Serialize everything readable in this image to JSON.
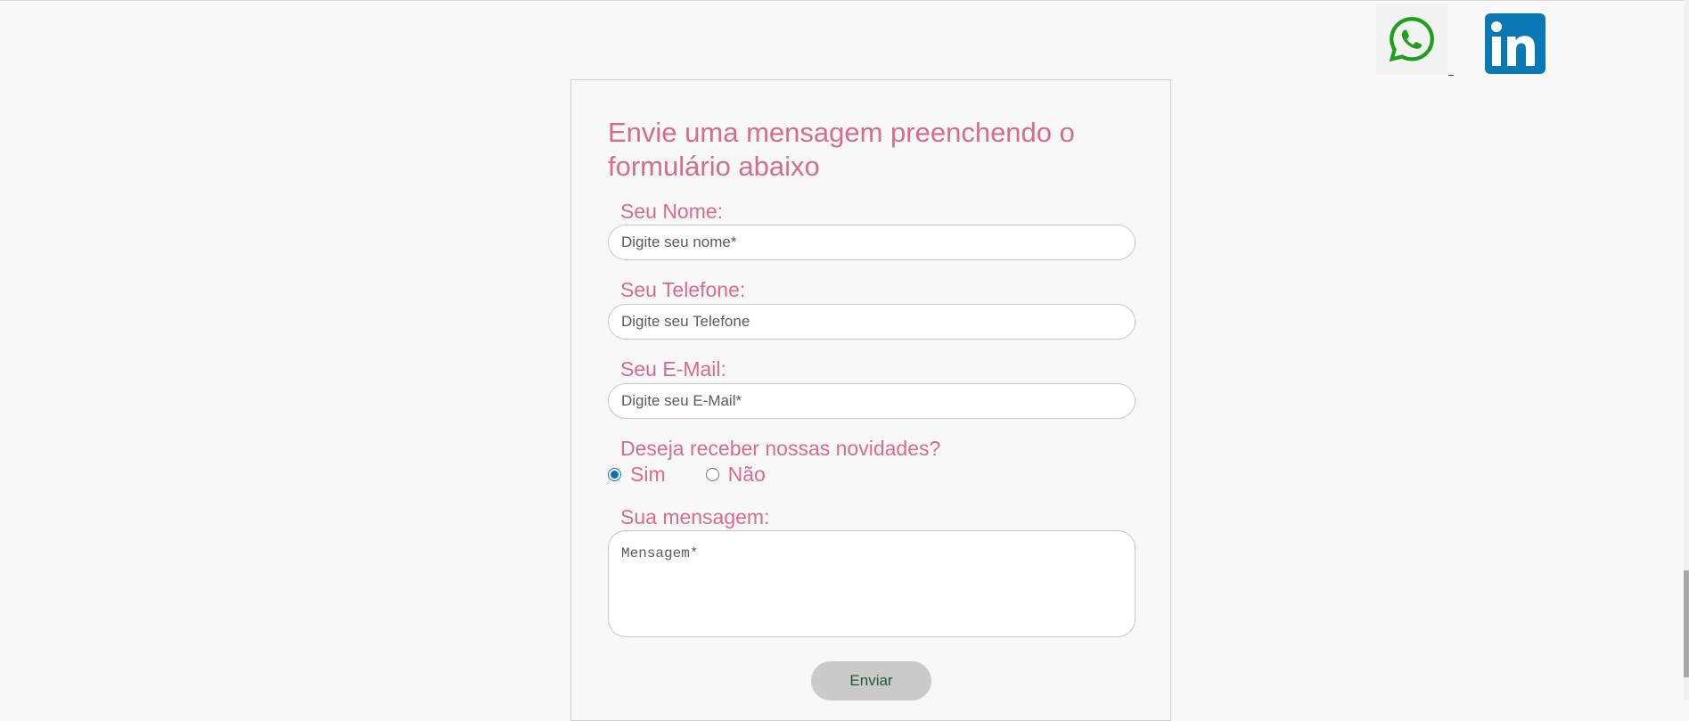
{
  "social": {
    "whatsapp_icon": "whatsapp-icon",
    "linkedin_icon": "linkedin-icon",
    "whatsapp_color": "#1ea01e",
    "linkedin_color": "#0a78b5"
  },
  "form": {
    "title": "Envie uma mensagem preenchendo o formulário abaixo",
    "name_label": "Seu Nome:",
    "name_placeholder": "Digite seu nome*",
    "name_value": "",
    "phone_label": "Seu Telefone:",
    "phone_placeholder": "Digite seu Telefone",
    "phone_value": "",
    "email_label": "Seu E-Mail:",
    "email_placeholder": "Digite seu E-Mail*",
    "email_value": "",
    "newsletter_question": "Deseja receber nossas novidades?",
    "newsletter_options": [
      {
        "label": "Sim",
        "checked": true
      },
      {
        "label": "Não",
        "checked": false
      }
    ],
    "message_label": "Sua mensagem:",
    "message_placeholder": "Mensagem*",
    "message_value": "",
    "submit_label": "Enviar"
  },
  "colors": {
    "accent_pink": "#d86c8e",
    "button_bg": "#c9cac9",
    "button_text": "#1e5a38",
    "page_bg": "#f8f8f8"
  }
}
